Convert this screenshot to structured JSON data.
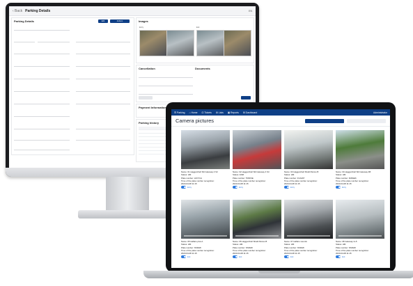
{
  "monitor": {
    "back": "‹ Back",
    "title": "Parking Details",
    "lang": "EN",
    "details_heading": "Parking Details",
    "btn_edit": "Edit",
    "btn_action": "Actions",
    "images_heading": "Images",
    "entry_label": "Entry",
    "exit_label": "Exit",
    "cancellation_heading": "Cancellation",
    "documents_heading": "Documents",
    "payment_heading": "Payment Information",
    "history_heading": "Parking history",
    "colors": {
      "primary": "#0e3f86"
    }
  },
  "laptop": {
    "nav": [
      "☰ Parking",
      "⌂ Home",
      "⊡ Tickets",
      "⚙ Lists",
      "▣ Reports",
      "⊞ Dashboard"
    ],
    "nav_right": "Administrator",
    "title": "Camera pictures",
    "tab_active": "",
    "tab_inactive": "",
    "cards": [
      {
        "line1": "Name: 01 Haggarchell Stlt Gateway 4 Str",
        "line2": "Status: HM",
        "line3": "Plate number: LM 8 KA",
        "line4": "Time of the plate number recognition:",
        "line5": "2023-04-08 11:15",
        "toggle": "Entry"
      },
      {
        "line1": "Name: 02 Haggarchell Stlt Gateway 4 Str",
        "line2": "Status: ANM",
        "line3": "Plate number: TR0FKE",
        "line4": "Time of the plate number recognition:",
        "line5": "2023-04-08 11:15",
        "toggle": "Entry"
      },
      {
        "line1": "Name: 03 Haggarchell Shalit Parcus B",
        "line2": "Status: HM",
        "line3": "Plate number: FCA467",
        "line4": "Time of the plate number recognition:",
        "line5": "2023-04-08 11:15",
        "toggle": "Entry"
      },
      {
        "line1": "Name: 04 Haggarchell Stlt Gateway 4B",
        "line2": "Status: HM",
        "line3": "Plate number: RJ8HE6",
        "line4": "Time of the plate number recognition:",
        "line5": "2023-04-08 11:15",
        "toggle": "Entry"
      },
      {
        "line1": "Name: 05 Haflaro plus A",
        "line2": "Status: HM",
        "line3": "Plate number: NSRH8",
        "line4": "Time of the plate number recognition:",
        "line5": "2023-04-08 11:15",
        "toggle": "Exit"
      },
      {
        "line1": "Name: 06 Haggarchell Shalit Parcus B",
        "line2": "Status: HM",
        "line3": "Plate number: NSRH8",
        "line4": "Time of the plate number recognition:",
        "line5": "2023-04-08 11:15",
        "toggle": "Exit"
      },
      {
        "line1": "Name: 07 Haflaro sounds",
        "line2": "Status: HM",
        "line3": "Plate number: NSRH8",
        "line4": "Time of the plate number recognition:",
        "line5": "2023-04-08 11:15",
        "toggle": "Exit"
      },
      {
        "line1": "Name: 08 Gateway 4+5",
        "line2": "Status: HM",
        "line3": "Plate number: NSRH8",
        "line4": "Time of the plate number recognition:",
        "line5": "2023-04-08 11:15",
        "toggle": "Exit"
      }
    ],
    "colors": {
      "nav": "#0e3f86",
      "toggle": "#2d7be0"
    }
  }
}
